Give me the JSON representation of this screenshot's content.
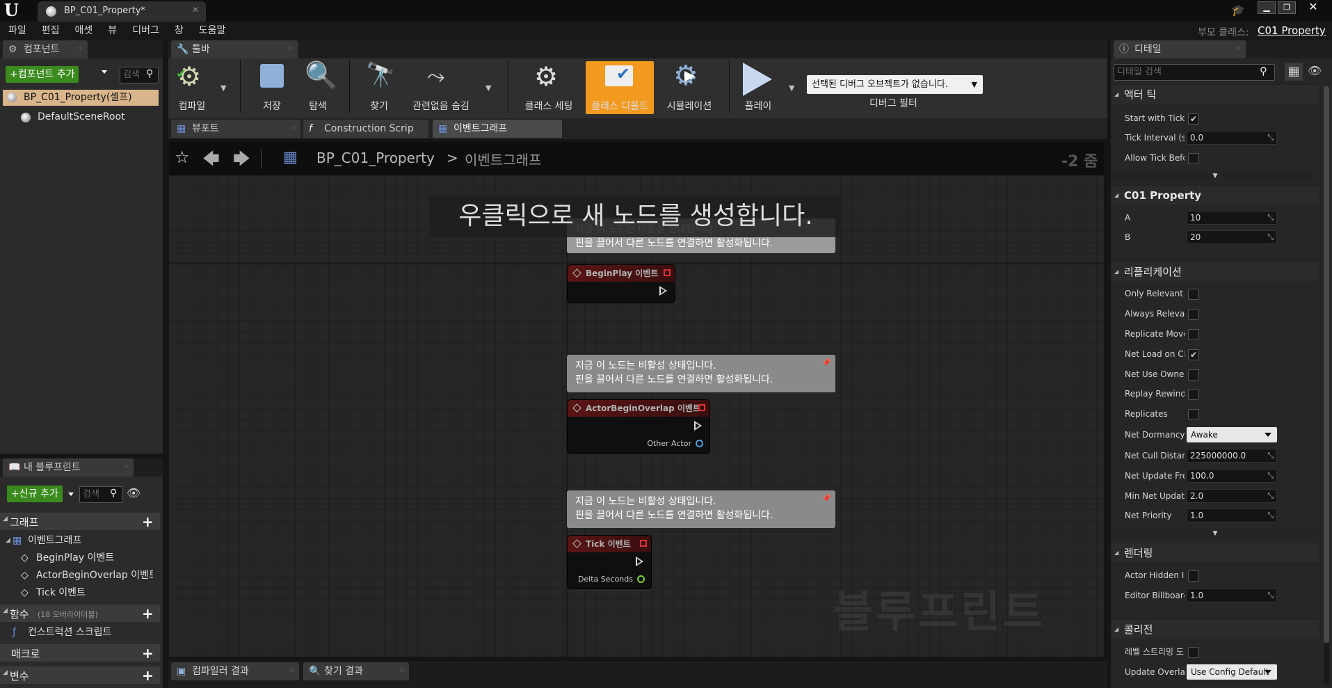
{
  "app": {
    "logo_text": "U",
    "doc_tab": "BP_C01_Property*",
    "parent_class_label": "부모 클래스:",
    "parent_class_value": "C01 Property"
  },
  "menu": [
    "파일",
    "편집",
    "애셋",
    "뷰",
    "디버그",
    "창",
    "도움말"
  ],
  "components": {
    "tab": "컴포넌트",
    "add_button": "+컴포넌트 추가",
    "search_placeholder": "검색",
    "root_item": "BP_C01_Property(셀프)",
    "child_item": "DefaultSceneRoot"
  },
  "my_blueprint": {
    "tab": "내 블루프린트",
    "add_button": "+신규 추가",
    "search_placeholder": "검색",
    "graphs_label": "그래프",
    "event_graph": "이벤트그래프",
    "events": [
      "BeginPlay 이벤트",
      "ActorBeginOverlap 이벤트",
      "Tick 이벤트"
    ],
    "functions_label": "함수",
    "functions_note": "(18 오버라이더블)",
    "construction_script": "컨스트럭션 스크립트",
    "macros_label": "매크로",
    "variables_label": "변수"
  },
  "toolbar": {
    "tab": "툴바",
    "buttons": {
      "compile": "컴파일",
      "save": "저장",
      "browse": "탐색",
      "find": "찾기",
      "hide_unrelated": "관련없음 숨김",
      "class_settings": "클래스 세팅",
      "class_defaults": "클래스 디폴트",
      "simulation": "시뮬레이션",
      "play": "플레이"
    },
    "debug_select": "선택된 디버그 오브젝트가 없습니다.",
    "debug_filter": "디버그 필터"
  },
  "editor_tabs": [
    "뷰포트",
    "Construction Scrip",
    "이벤트그래프"
  ],
  "graph": {
    "breadcrumb_bp": "BP_C01_Property",
    "breadcrumb_sep": ">",
    "breadcrumb_graph": "이벤트그래프",
    "zoom": "-2 줌",
    "hint": "우클릭으로 새 노드를 생성합니다.",
    "watermark": "블루프린트",
    "comment_line1": "지금 이 노드는 비활성 상태입니다.",
    "comment_line2": "핀을 끌어서 다른 노드를 연결하면 활성화됩니다.",
    "nodes": [
      {
        "title": "BeginPlay 이벤트",
        "pin": ""
      },
      {
        "title": "ActorBeginOverlap 이벤트",
        "pin": "Other Actor"
      },
      {
        "title": "Tick 이벤트",
        "pin": "Delta Seconds"
      }
    ]
  },
  "bottom_tabs": [
    "컴파일러 결과",
    "찾기 결과"
  ],
  "details": {
    "tab": "디테일",
    "search_placeholder": "디테일 검색",
    "sections": {
      "actor_tick": "액터 틱",
      "c01": "C01 Property",
      "replication": "리플리케이션",
      "rendering": "렌더링",
      "collision": "콜리전"
    },
    "tick": [
      {
        "name": "Start with Tick",
        "checked": true
      },
      {
        "name": "Tick Interval (s",
        "value": "0.0"
      },
      {
        "name": "Allow Tick Befo",
        "checked": false
      }
    ],
    "c01": [
      {
        "name": "A",
        "value": "10"
      },
      {
        "name": "B",
        "value": "20"
      }
    ],
    "replication": [
      {
        "name": "Only Relevant t",
        "checked": false
      },
      {
        "name": "Always Releva",
        "checked": false
      },
      {
        "name": "Replicate Move",
        "checked": false
      },
      {
        "name": "Net Load on Cl",
        "checked": true
      },
      {
        "name": "Net Use Owne",
        "checked": false
      },
      {
        "name": "Replay Rewind",
        "checked": false
      },
      {
        "name": "Replicates",
        "checked": false
      },
      {
        "name": "Net Dormancy",
        "select": "Awake"
      },
      {
        "name": "Net Cull Distan",
        "value": "225000000.0"
      },
      {
        "name": "Net Update Fre",
        "value": "100.0"
      },
      {
        "name": "Min Net Update",
        "value": "2.0"
      },
      {
        "name": "Net Priority",
        "value": "1.0"
      }
    ],
    "rendering": [
      {
        "name": "Actor Hidden In",
        "checked": false
      },
      {
        "name": "Editor Billboard",
        "value": "1.0"
      }
    ],
    "collision": [
      {
        "name": "레벨 스트리밍 도",
        "checked": false
      },
      {
        "name": "Update Overlap",
        "select": "Use Config Default"
      }
    ]
  },
  "colors": {
    "accent_orange": "#f29a1e",
    "green_button": "#3b8a1e",
    "node_header": "#5a1414"
  }
}
